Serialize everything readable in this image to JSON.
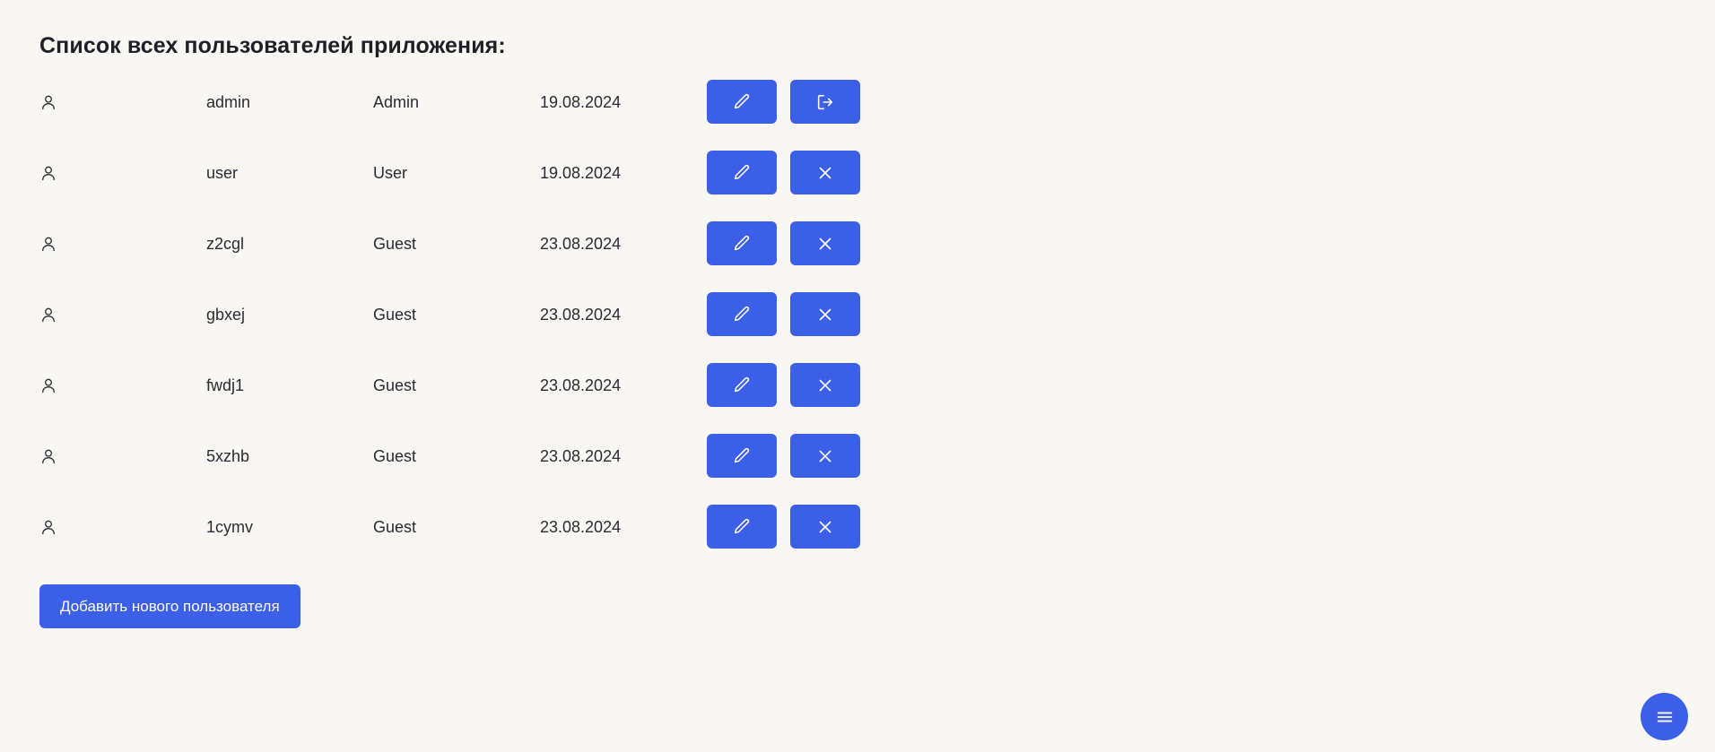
{
  "page": {
    "title": "Список всех пользователей приложения:",
    "add_button_label": "Добавить нового пользователя"
  },
  "users": [
    {
      "login": "admin",
      "role": "Admin",
      "date": "19.08.2024",
      "secondary_action_icon": "logout-icon"
    },
    {
      "login": "user",
      "role": "User",
      "date": "19.08.2024",
      "secondary_action_icon": "close-icon"
    },
    {
      "login": "z2cgl",
      "role": "Guest",
      "date": "23.08.2024",
      "secondary_action_icon": "close-icon"
    },
    {
      "login": "gbxej",
      "role": "Guest",
      "date": "23.08.2024",
      "secondary_action_icon": "close-icon"
    },
    {
      "login": "fwdj1",
      "role": "Guest",
      "date": "23.08.2024",
      "secondary_action_icon": "close-icon"
    },
    {
      "login": "5xzhb",
      "role": "Guest",
      "date": "23.08.2024",
      "secondary_action_icon": "close-icon"
    },
    {
      "login": "1cymv",
      "role": "Guest",
      "date": "23.08.2024",
      "secondary_action_icon": "close-icon"
    }
  ],
  "icons": {
    "row_icon": "user-icon",
    "edit_icon": "pencil-icon",
    "fab_icon": "menu-icon"
  },
  "colors": {
    "accent": "#3c5fe8",
    "background": "#f8f7f4",
    "text": "#2b2b33"
  }
}
